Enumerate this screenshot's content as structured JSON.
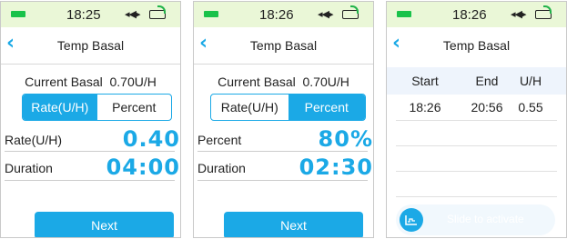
{
  "colors": {
    "accent": "#1ba9e6",
    "statusbar_bg": "#eaf7d7",
    "table_header_bg": "#eef4fc"
  },
  "screens": [
    {
      "status": {
        "time": "18:25",
        "vibrate": "◂◀▸"
      },
      "title": "Temp Basal",
      "current_basal_label": "Current Basal",
      "current_basal_value": "0.70U/H",
      "segment": {
        "left": "Rate(U/H)",
        "right": "Percent",
        "selected": "left"
      },
      "rows": [
        {
          "label": "Rate(U/H)",
          "value": "0.40"
        },
        {
          "label": "Duration",
          "value": "04:00"
        }
      ],
      "next_label": "Next"
    },
    {
      "status": {
        "time": "18:26",
        "vibrate": "◂◀▸"
      },
      "title": "Temp Basal",
      "current_basal_label": "Current Basal",
      "current_basal_value": "0.70U/H",
      "segment": {
        "left": "Rate(U/H)",
        "right": "Percent",
        "selected": "right"
      },
      "rows": [
        {
          "label": "Percent",
          "value": "80%"
        },
        {
          "label": "Duration",
          "value": "02:30"
        }
      ],
      "next_label": "Next"
    },
    {
      "status": {
        "time": "18:26",
        "vibrate": "◂◀▸"
      },
      "title": "Temp Basal",
      "table": {
        "headers": [
          "Start",
          "End",
          "U/H"
        ],
        "rows": [
          [
            "18:26",
            "20:56",
            "0.55"
          ]
        ]
      },
      "slider_label": "Slide to activate"
    }
  ]
}
